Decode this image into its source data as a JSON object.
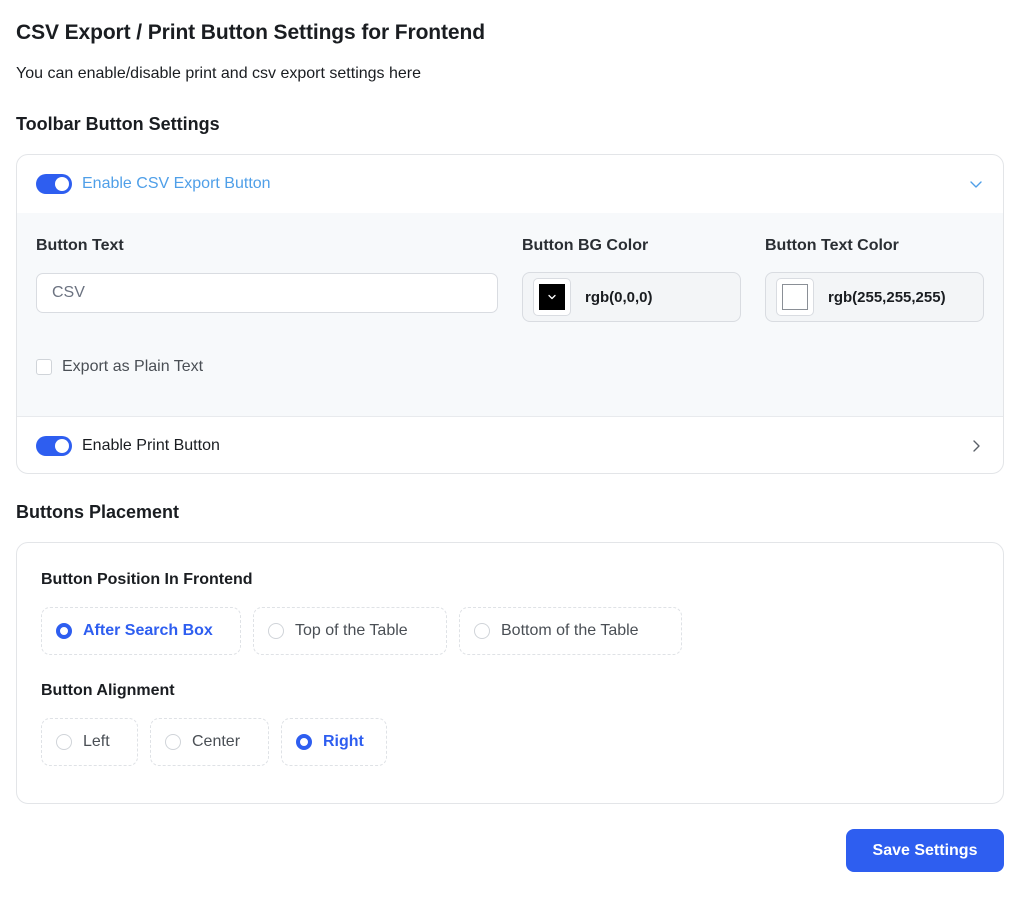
{
  "header": {
    "title": "CSV Export / Print Button Settings for Frontend",
    "subtitle": "You can enable/disable print and csv export settings here"
  },
  "toolbar": {
    "section_title": "Toolbar Button Settings",
    "csv": {
      "label": "Enable CSV Export Button",
      "enabled": true,
      "expanded": true,
      "button_text_label": "Button Text",
      "button_text_value": "CSV",
      "bg_color_label": "Button BG Color",
      "bg_color_value": "rgb(0,0,0)",
      "text_color_label": "Button Text Color",
      "text_color_value": "rgb(255,255,255)",
      "plain_text_label": "Export as Plain Text",
      "plain_text_checked": false
    },
    "print": {
      "label": "Enable Print Button",
      "enabled": true,
      "expanded": false
    }
  },
  "placement": {
    "section_title": "Buttons Placement",
    "position_label": "Button Position In Frontend",
    "position_options": [
      "After Search Box",
      "Top of the Table",
      "Bottom of the Table"
    ],
    "position_selected": "After Search Box",
    "alignment_label": "Button Alignment",
    "alignment_options": [
      "Left",
      "Center",
      "Right"
    ],
    "alignment_selected": "Right"
  },
  "actions": {
    "save_label": "Save Settings"
  },
  "colors": {
    "accent": "#2e5ef0",
    "active_label": "#4f9fe8"
  }
}
